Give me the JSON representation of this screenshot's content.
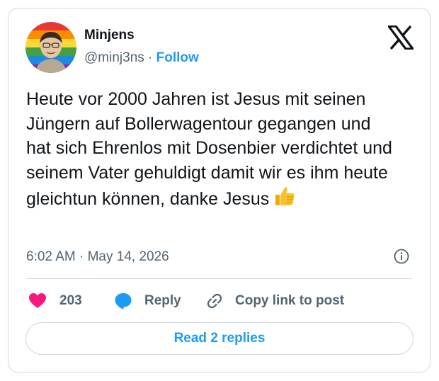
{
  "author": {
    "display_name": "Minjens",
    "handle": "@minj3ns",
    "separator": "·",
    "follow_label": "Follow",
    "avatar": "avatar-rainbow-portrait"
  },
  "tweet": {
    "text": "Heute vor 2000 Jahren ist Jesus mit seinen Jüngern auf Bollerwagentour gegangen und hat sich Ehrenlos mit Dosenbier verdichtet und seinem Vater gehuldigt damit wir es ihm heute gleichtun können, danke Jesus",
    "emoji": "thumbs-up-icon",
    "timestamp": "6:02 AM · May 14, 2026"
  },
  "actions": {
    "like_count": "203",
    "reply_label": "Reply",
    "copy_label": "Copy link to post"
  },
  "footer": {
    "read_replies_label": "Read 2 replies"
  },
  "icons": {
    "logo": "x-logo-icon",
    "info": "info-icon",
    "like": "heart-icon",
    "reply": "reply-bubble-icon",
    "copy": "link-icon"
  },
  "colors": {
    "accent": "#1d9bf0",
    "heart": "#f91880",
    "muted": "#536471",
    "text": "#0f1419",
    "border": "#cfd9de"
  }
}
